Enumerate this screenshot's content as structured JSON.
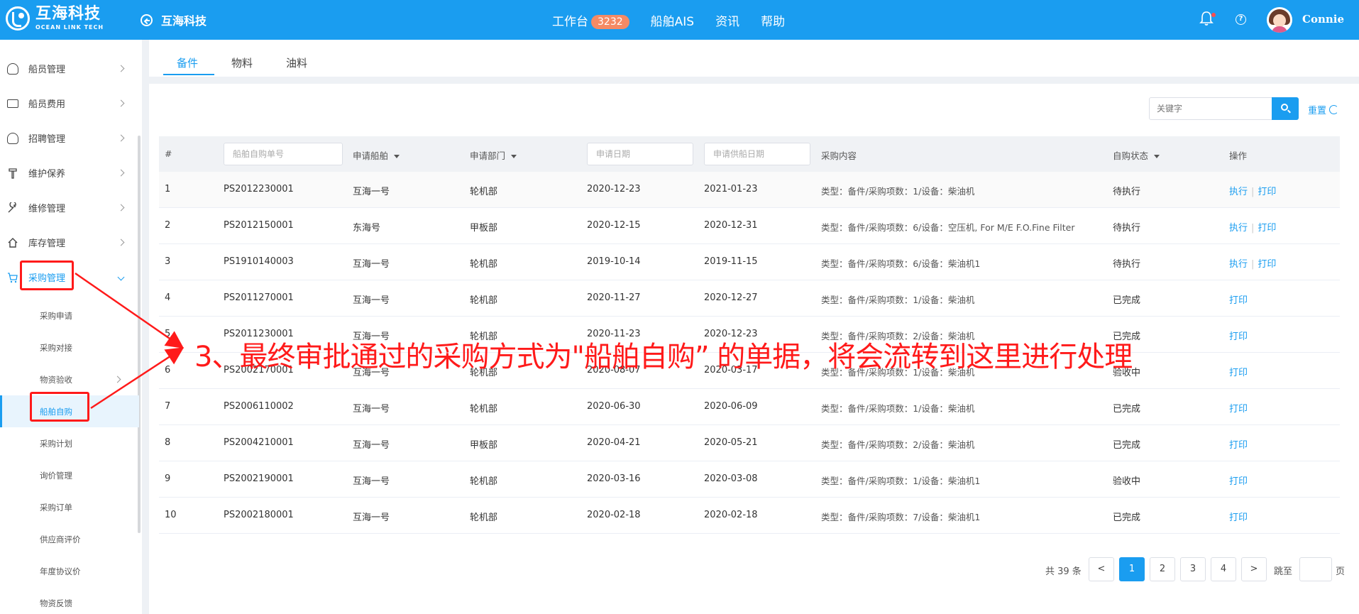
{
  "header": {
    "logo_cn": "互海科技",
    "logo_en": "OCEAN LINK TECH",
    "back_label": "互海科技",
    "nav": [
      {
        "label": "工作台",
        "badge": "3232"
      },
      {
        "label": "船舶AIS"
      },
      {
        "label": "资讯"
      },
      {
        "label": "帮助"
      }
    ],
    "help_glyph": "?",
    "username": "Connie"
  },
  "sidebar": {
    "items": [
      {
        "label": "船员管理",
        "icon": "user-icon"
      },
      {
        "label": "船员费用",
        "icon": "wallet-icon"
      },
      {
        "label": "招聘管理",
        "icon": "user-search-icon"
      },
      {
        "label": "维护保养",
        "icon": "hammer-icon"
      },
      {
        "label": "维修管理",
        "icon": "wrench-icon"
      },
      {
        "label": "库存管理",
        "icon": "home-icon"
      },
      {
        "label": "采购管理",
        "icon": "cart-icon",
        "expanded": true
      }
    ],
    "sub_items": [
      {
        "label": "采购申请"
      },
      {
        "label": "采购对接"
      },
      {
        "label": "物资验收",
        "has_children": true
      },
      {
        "label": "船舶自购",
        "selected": true
      },
      {
        "label": "采购计划"
      },
      {
        "label": "询价管理"
      },
      {
        "label": "采购订单"
      },
      {
        "label": "供应商评价"
      },
      {
        "label": "年度协议价"
      },
      {
        "label": "物资反馈"
      }
    ]
  },
  "tabs": [
    "备件",
    "物料",
    "油料"
  ],
  "toolbar": {
    "search_placeholder": "关键字",
    "reset_label": "重置"
  },
  "table": {
    "headers": {
      "index": "#",
      "order_no_placeholder": "船舶自购单号",
      "ship": "申请船舶",
      "dept": "申请部门",
      "apply_date_placeholder": "申请日期",
      "supply_date_placeholder": "申请供船日期",
      "content": "采购内容",
      "status": "自购状态",
      "actions": "操作"
    },
    "rows": [
      {
        "idx": "1",
        "no": "PS2012230001",
        "ship": "互海一号",
        "dept": "轮机部",
        "apply": "2020-12-23",
        "supply": "2021-01-23",
        "content": "类型：备件/采购项数：1/设备：柴油机",
        "status": "待执行",
        "act1": "执行",
        "act2": "打印"
      },
      {
        "idx": "2",
        "no": "PS2012150001",
        "ship": "东海号",
        "dept": "甲板部",
        "apply": "2020-12-15",
        "supply": "2020-12-31",
        "content": "类型：备件/采购项数：6/设备：空压机, For M/E F.O.Fine Filter",
        "status": "待执行",
        "act1": "执行",
        "act2": "打印"
      },
      {
        "idx": "3",
        "no": "PS1910140003",
        "ship": "互海一号",
        "dept": "轮机部",
        "apply": "2019-10-14",
        "supply": "2019-11-15",
        "content": "类型：备件/采购项数：6/设备：柴油机1",
        "status": "待执行",
        "act1": "执行",
        "act2": "打印"
      },
      {
        "idx": "4",
        "no": "PS2011270001",
        "ship": "互海一号",
        "dept": "轮机部",
        "apply": "2020-11-27",
        "supply": "2020-12-27",
        "content": "类型：备件/采购项数：1/设备：柴油机",
        "status": "已完成",
        "act1": "打印"
      },
      {
        "idx": "5",
        "no": "PS2011230001",
        "ship": "互海一号",
        "dept": "轮机部",
        "apply": "2020-11-23",
        "supply": "2020-12-23",
        "content": "类型：备件/采购项数：2/设备：柴油机",
        "status": "已完成",
        "act1": "打印"
      },
      {
        "idx": "6",
        "no": "PS2002170001",
        "ship": "互海一号",
        "dept": "轮机部",
        "apply": "2020-08-07",
        "supply": "2020-03-17",
        "content": "类型：备件/采购项数：1/设备：柴油机",
        "status": "验收中",
        "act1": "打印"
      },
      {
        "idx": "7",
        "no": "PS2006110002",
        "ship": "互海一号",
        "dept": "轮机部",
        "apply": "2020-06-30",
        "supply": "2020-06-09",
        "content": "类型：备件/采购项数：1/设备：柴油机",
        "status": "已完成",
        "act1": "打印"
      },
      {
        "idx": "8",
        "no": "PS2004210001",
        "ship": "互海一号",
        "dept": "甲板部",
        "apply": "2020-04-21",
        "supply": "2020-05-21",
        "content": "类型：备件/采购项数：2/设备：柴油机",
        "status": "已完成",
        "act1": "打印"
      },
      {
        "idx": "9",
        "no": "PS2002190001",
        "ship": "互海一号",
        "dept": "轮机部",
        "apply": "2020-03-16",
        "supply": "2020-03-08",
        "content": "类型：备件/采购项数：1/设备：柴油机1",
        "status": "验收中",
        "act1": "打印"
      },
      {
        "idx": "10",
        "no": "PS2002180001",
        "ship": "互海一号",
        "dept": "轮机部",
        "apply": "2020-02-18",
        "supply": "2020-02-18",
        "content": "类型：备件/采购项数：7/设备：柴油机1",
        "status": "已完成",
        "act1": "打印"
      }
    ]
  },
  "pagination": {
    "total": "共 39 条",
    "prev": "<",
    "pages": [
      "1",
      "2",
      "3",
      "4"
    ],
    "current": "1",
    "next": ">",
    "jump_label": "跳至",
    "page_label": "页"
  },
  "annotation": {
    "text": "3、最终审批通过的采购方式为\"船舶自购” 的单据，将会流转到这里进行处理",
    "color": "#ff1a1a"
  },
  "colors": {
    "accent": "#1a9df0",
    "badge": "#f58a64",
    "annotation": "#ff1a1a"
  }
}
